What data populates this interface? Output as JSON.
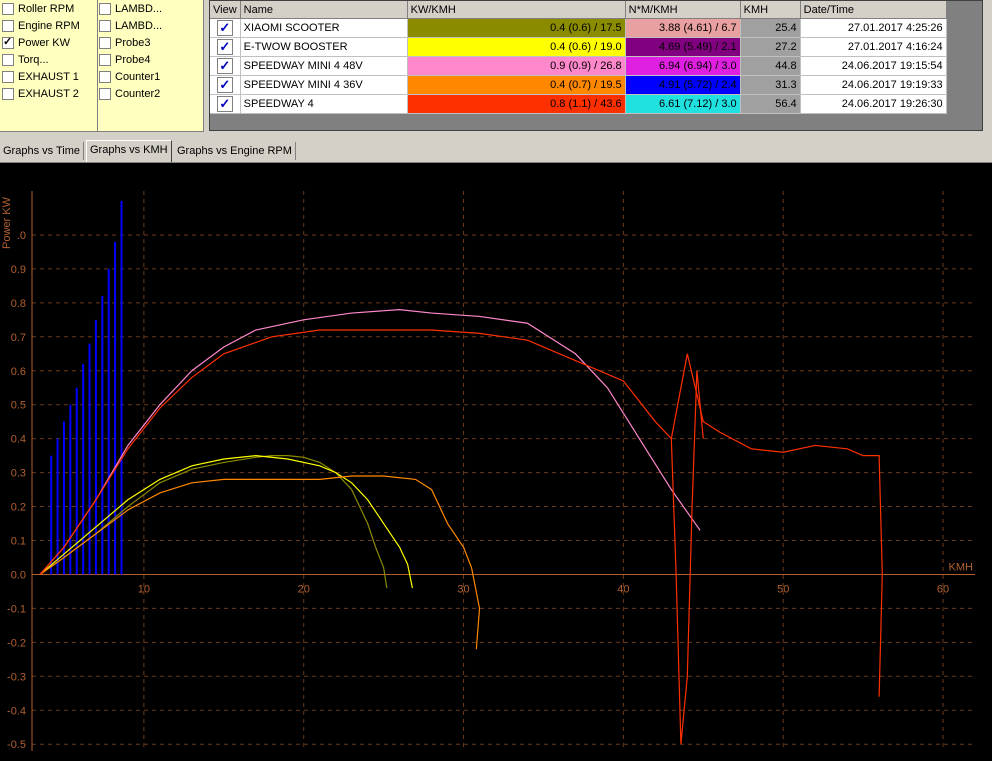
{
  "channels": {
    "col1": [
      {
        "label": "Roller RPM",
        "checked": false
      },
      {
        "label": "Engine RPM",
        "checked": false
      },
      {
        "label": "Power KW",
        "checked": true
      },
      {
        "label": "Torq...",
        "checked": false
      },
      {
        "label": "EXHAUST 1",
        "checked": false
      },
      {
        "label": "EXHAUST 2",
        "checked": false
      }
    ],
    "col2": [
      {
        "label": "LAMBD...",
        "checked": false
      },
      {
        "label": "LAMBD...",
        "checked": false
      },
      {
        "label": "Probe3",
        "checked": false
      },
      {
        "label": "Probe4",
        "checked": false
      },
      {
        "label": "Counter1",
        "checked": false
      },
      {
        "label": "Counter2",
        "checked": false
      }
    ]
  },
  "table": {
    "headers": [
      "View",
      "Name",
      "KW/KMH",
      "N*M/KMH",
      "KMH",
      "Date/Time"
    ],
    "rows": [
      {
        "name": "XIAOMI SCOOTER",
        "kw": "0.4 (0.6) / 17.5",
        "nm": "3.88 (4.61) / 6.7",
        "kmh": "25.4",
        "date": "27.01.2017 4:25:26",
        "kw_color": "#8b8b00",
        "nm_color": "#e8a0a0"
      },
      {
        "name": "E-TWOW BOOSTER",
        "kw": "0.4 (0.6) / 19.0",
        "nm": "4.69 (5.49) / 2.1",
        "kmh": "27.2",
        "date": "27.01.2017 4:16:24",
        "kw_color": "#ffff00",
        "nm_color": "#800080"
      },
      {
        "name": "SPEEDWAY MINI 4 48V",
        "kw": "0.9 (0.9) / 26.8",
        "nm": "6.94 (6.94) / 3.0",
        "kmh": "44.8",
        "date": "24.06.2017 19:15:54",
        "kw_color": "#ff88cc",
        "nm_color": "#e020e0"
      },
      {
        "name": "SPEEDWAY MINI 4 36V",
        "kw": "0.4 (0.7) / 19.5",
        "nm": "4.91 (5.72) / 2.4",
        "kmh": "31.3",
        "date": "24.06.2017 19:19:33",
        "kw_color": "#ff8800",
        "nm_color": "#0000ff"
      },
      {
        "name": "SPEEDWAY 4",
        "kw": "0.8 (1.1) / 43.6",
        "nm": "6.61 (7.12) / 3.0",
        "kmh": "56.4",
        "date": "24.06.2017 19:26:30",
        "kw_color": "#ff3000",
        "nm_color": "#20e0e0"
      }
    ]
  },
  "tabs": [
    "Graphs vs Time",
    "Graphs vs KMH",
    "Graphs vs Engine RPM"
  ],
  "active_tab": 1,
  "chart_data": {
    "type": "line",
    "ylabel": "Power KW",
    "xlabel": "KMH",
    "xlim": [
      3,
      62
    ],
    "ylim": [
      -0.52,
      1.1
    ],
    "xticks": [
      10,
      20,
      30,
      40,
      50,
      60
    ],
    "yticks": [
      1.0,
      0.9,
      0.8,
      0.7,
      0.6,
      0.5,
      0.4,
      0.3,
      0.2,
      0.1,
      0.0,
      -0.1,
      -0.2,
      -0.3,
      -0.4,
      -0.5
    ],
    "ytick_labels": [
      ".0",
      "0.9",
      "0.8",
      "0.7",
      "0.6",
      "0.5",
      "0.4",
      "0.3",
      "0.2",
      "0.1",
      "0.0",
      "-0.1",
      "-0.2",
      "-0.3",
      "-0.4",
      "-0.5"
    ],
    "grid": true,
    "series": [
      {
        "color": "#8b8b00",
        "x": [
          3.5,
          5,
          7,
          9,
          11,
          13,
          15,
          17,
          18,
          19,
          20,
          21,
          22,
          23,
          24,
          24.5,
          25,
          25.2
        ],
        "y": [
          0,
          0.05,
          0.12,
          0.2,
          0.27,
          0.31,
          0.33,
          0.345,
          0.35,
          0.35,
          0.345,
          0.33,
          0.3,
          0.25,
          0.15,
          0.08,
          0.02,
          -0.04
        ]
      },
      {
        "color": "#ffff00",
        "x": [
          3.5,
          5,
          7,
          9,
          11,
          13,
          15,
          17,
          19,
          21,
          22,
          23,
          24,
          25,
          26,
          26.5,
          26.8
        ],
        "y": [
          0,
          0.06,
          0.14,
          0.22,
          0.28,
          0.32,
          0.34,
          0.35,
          0.34,
          0.32,
          0.3,
          0.27,
          0.22,
          0.15,
          0.08,
          0.03,
          -0.04
        ]
      },
      {
        "color": "#ff88cc",
        "x": [
          3.5,
          5,
          7,
          9,
          11,
          13,
          15,
          17,
          20,
          23,
          26,
          28,
          31,
          34,
          37,
          39,
          41,
          43,
          44.8
        ],
        "y": [
          0,
          0.08,
          0.22,
          0.38,
          0.5,
          0.6,
          0.67,
          0.72,
          0.75,
          0.77,
          0.78,
          0.77,
          0.76,
          0.74,
          0.65,
          0.55,
          0.4,
          0.25,
          0.13
        ]
      },
      {
        "color": "#ff8800",
        "x": [
          3.5,
          5,
          7,
          9,
          11,
          13,
          15,
          17,
          19,
          21,
          23,
          25,
          27,
          28,
          29,
          30,
          30.5,
          31,
          30.8
        ],
        "y": [
          0,
          0.05,
          0.12,
          0.19,
          0.24,
          0.27,
          0.28,
          0.28,
          0.28,
          0.28,
          0.29,
          0.29,
          0.28,
          0.25,
          0.15,
          0.08,
          0.02,
          -0.1,
          -0.22
        ]
      },
      {
        "color": "#ff3000",
        "x": [
          3.5,
          5,
          7,
          9,
          11,
          13,
          15,
          18,
          21,
          25,
          28,
          31,
          34,
          37,
          40,
          42,
          43,
          44,
          45,
          46,
          48,
          50,
          52,
          54,
          55,
          56,
          56.2,
          56
        ],
        "y": [
          0,
          0.08,
          0.22,
          0.37,
          0.49,
          0.58,
          0.65,
          0.7,
          0.72,
          0.72,
          0.72,
          0.71,
          0.69,
          0.63,
          0.57,
          0.45,
          0.4,
          0.65,
          0.45,
          0.42,
          0.37,
          0.36,
          0.38,
          0.37,
          0.35,
          0.35,
          0.0,
          -0.36
        ]
      },
      {
        "color": "#ff3000",
        "x": [
          43,
          43.3,
          43.6,
          44,
          44.3,
          44.6,
          45
        ],
        "y": [
          0.4,
          0.0,
          -0.5,
          -0.3,
          0.2,
          0.6,
          0.4
        ]
      }
    ],
    "bars_series": {
      "color": "#0000ff",
      "x": [
        4.2,
        4.6,
        5.0,
        5.4,
        5.8,
        6.2,
        6.6,
        7.0,
        7.4,
        7.8,
        8.2,
        8.6
      ],
      "y": [
        0.35,
        0.4,
        0.45,
        0.5,
        0.55,
        0.62,
        0.68,
        0.75,
        0.82,
        0.9,
        0.98,
        1.1
      ]
    }
  }
}
